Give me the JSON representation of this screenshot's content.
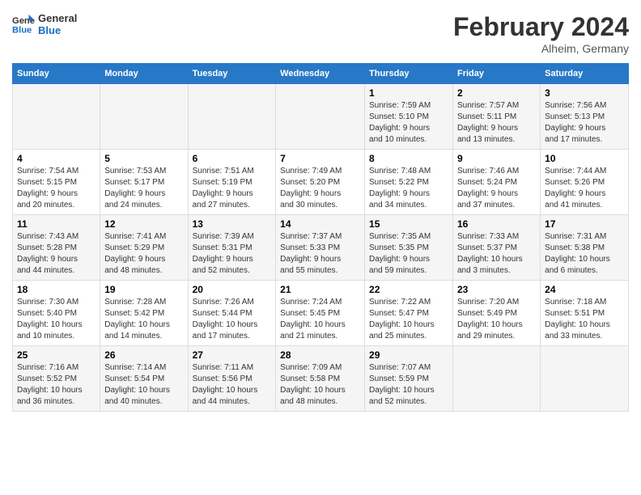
{
  "header": {
    "logo_general": "General",
    "logo_blue": "Blue",
    "title": "February 2024",
    "location": "Alheim, Germany"
  },
  "weekdays": [
    "Sunday",
    "Monday",
    "Tuesday",
    "Wednesday",
    "Thursday",
    "Friday",
    "Saturday"
  ],
  "weeks": [
    [
      {
        "day": "",
        "info": ""
      },
      {
        "day": "",
        "info": ""
      },
      {
        "day": "",
        "info": ""
      },
      {
        "day": "",
        "info": ""
      },
      {
        "day": "1",
        "info": "Sunrise: 7:59 AM\nSunset: 5:10 PM\nDaylight: 9 hours\nand 10 minutes."
      },
      {
        "day": "2",
        "info": "Sunrise: 7:57 AM\nSunset: 5:11 PM\nDaylight: 9 hours\nand 13 minutes."
      },
      {
        "day": "3",
        "info": "Sunrise: 7:56 AM\nSunset: 5:13 PM\nDaylight: 9 hours\nand 17 minutes."
      }
    ],
    [
      {
        "day": "4",
        "info": "Sunrise: 7:54 AM\nSunset: 5:15 PM\nDaylight: 9 hours\nand 20 minutes."
      },
      {
        "day": "5",
        "info": "Sunrise: 7:53 AM\nSunset: 5:17 PM\nDaylight: 9 hours\nand 24 minutes."
      },
      {
        "day": "6",
        "info": "Sunrise: 7:51 AM\nSunset: 5:19 PM\nDaylight: 9 hours\nand 27 minutes."
      },
      {
        "day": "7",
        "info": "Sunrise: 7:49 AM\nSunset: 5:20 PM\nDaylight: 9 hours\nand 30 minutes."
      },
      {
        "day": "8",
        "info": "Sunrise: 7:48 AM\nSunset: 5:22 PM\nDaylight: 9 hours\nand 34 minutes."
      },
      {
        "day": "9",
        "info": "Sunrise: 7:46 AM\nSunset: 5:24 PM\nDaylight: 9 hours\nand 37 minutes."
      },
      {
        "day": "10",
        "info": "Sunrise: 7:44 AM\nSunset: 5:26 PM\nDaylight: 9 hours\nand 41 minutes."
      }
    ],
    [
      {
        "day": "11",
        "info": "Sunrise: 7:43 AM\nSunset: 5:28 PM\nDaylight: 9 hours\nand 44 minutes."
      },
      {
        "day": "12",
        "info": "Sunrise: 7:41 AM\nSunset: 5:29 PM\nDaylight: 9 hours\nand 48 minutes."
      },
      {
        "day": "13",
        "info": "Sunrise: 7:39 AM\nSunset: 5:31 PM\nDaylight: 9 hours\nand 52 minutes."
      },
      {
        "day": "14",
        "info": "Sunrise: 7:37 AM\nSunset: 5:33 PM\nDaylight: 9 hours\nand 55 minutes."
      },
      {
        "day": "15",
        "info": "Sunrise: 7:35 AM\nSunset: 5:35 PM\nDaylight: 9 hours\nand 59 minutes."
      },
      {
        "day": "16",
        "info": "Sunrise: 7:33 AM\nSunset: 5:37 PM\nDaylight: 10 hours\nand 3 minutes."
      },
      {
        "day": "17",
        "info": "Sunrise: 7:31 AM\nSunset: 5:38 PM\nDaylight: 10 hours\nand 6 minutes."
      }
    ],
    [
      {
        "day": "18",
        "info": "Sunrise: 7:30 AM\nSunset: 5:40 PM\nDaylight: 10 hours\nand 10 minutes."
      },
      {
        "day": "19",
        "info": "Sunrise: 7:28 AM\nSunset: 5:42 PM\nDaylight: 10 hours\nand 14 minutes."
      },
      {
        "day": "20",
        "info": "Sunrise: 7:26 AM\nSunset: 5:44 PM\nDaylight: 10 hours\nand 17 minutes."
      },
      {
        "day": "21",
        "info": "Sunrise: 7:24 AM\nSunset: 5:45 PM\nDaylight: 10 hours\nand 21 minutes."
      },
      {
        "day": "22",
        "info": "Sunrise: 7:22 AM\nSunset: 5:47 PM\nDaylight: 10 hours\nand 25 minutes."
      },
      {
        "day": "23",
        "info": "Sunrise: 7:20 AM\nSunset: 5:49 PM\nDaylight: 10 hours\nand 29 minutes."
      },
      {
        "day": "24",
        "info": "Sunrise: 7:18 AM\nSunset: 5:51 PM\nDaylight: 10 hours\nand 33 minutes."
      }
    ],
    [
      {
        "day": "25",
        "info": "Sunrise: 7:16 AM\nSunset: 5:52 PM\nDaylight: 10 hours\nand 36 minutes."
      },
      {
        "day": "26",
        "info": "Sunrise: 7:14 AM\nSunset: 5:54 PM\nDaylight: 10 hours\nand 40 minutes."
      },
      {
        "day": "27",
        "info": "Sunrise: 7:11 AM\nSunset: 5:56 PM\nDaylight: 10 hours\nand 44 minutes."
      },
      {
        "day": "28",
        "info": "Sunrise: 7:09 AM\nSunset: 5:58 PM\nDaylight: 10 hours\nand 48 minutes."
      },
      {
        "day": "29",
        "info": "Sunrise: 7:07 AM\nSunset: 5:59 PM\nDaylight: 10 hours\nand 52 minutes."
      },
      {
        "day": "",
        "info": ""
      },
      {
        "day": "",
        "info": ""
      }
    ]
  ]
}
